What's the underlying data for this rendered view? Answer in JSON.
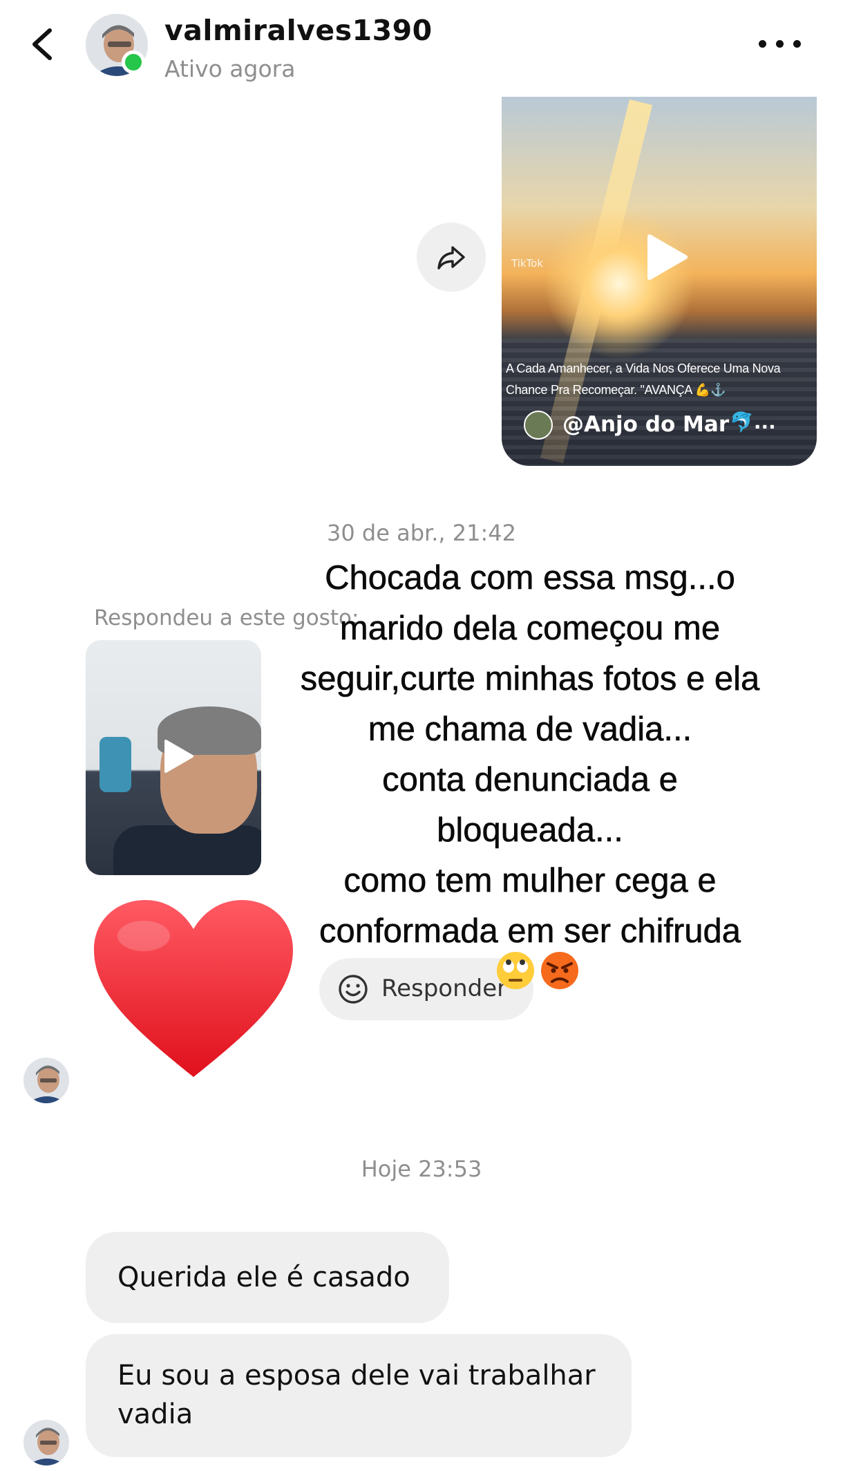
{
  "header": {
    "username": "valmiralves1390",
    "status": "Ativo agora"
  },
  "video_message": {
    "tiktok_tag": "TikTok",
    "caption": "A Cada Amanhecer, a Vida Nos Oferece Uma Nova Chance Pra Recomeçar. \"AVANÇA 💪⚓",
    "creator": "@Anjo do Mar",
    "creator_suffix": "🐬..."
  },
  "timestamps": {
    "first": "30 de abr., 21:42",
    "second": "Hoje 23:53"
  },
  "reply_context": {
    "label": "Respondeu a este gosto:"
  },
  "overlay_text": {
    "lines": [
      "Chocada com essa msg...o",
      "marido dela começou me",
      "seguir,curte minhas fotos e ela",
      "me chama de vadia...",
      "conta denunciada e",
      "bloqueada...",
      "como tem mulher cega e",
      "conformada em ser chifruda"
    ]
  },
  "reaction": {
    "label": "Responder",
    "emojis": [
      "🙄",
      "😡"
    ]
  },
  "messages": [
    {
      "text": "Querida ele é casado"
    },
    {
      "text": "Eu sou a esposa dele vai trabalhar vadia"
    }
  ],
  "icons": {
    "back": "chevron-left-icon",
    "more": "more-horizontal-icon",
    "share": "share-arrow-icon",
    "play": "play-icon",
    "smiley": "smiley-icon",
    "heart": "heart-icon"
  },
  "colors": {
    "online": "#25c64a",
    "bubble": "#efefef",
    "heart": "#f0232e",
    "muted_text": "#8e8e8e"
  }
}
